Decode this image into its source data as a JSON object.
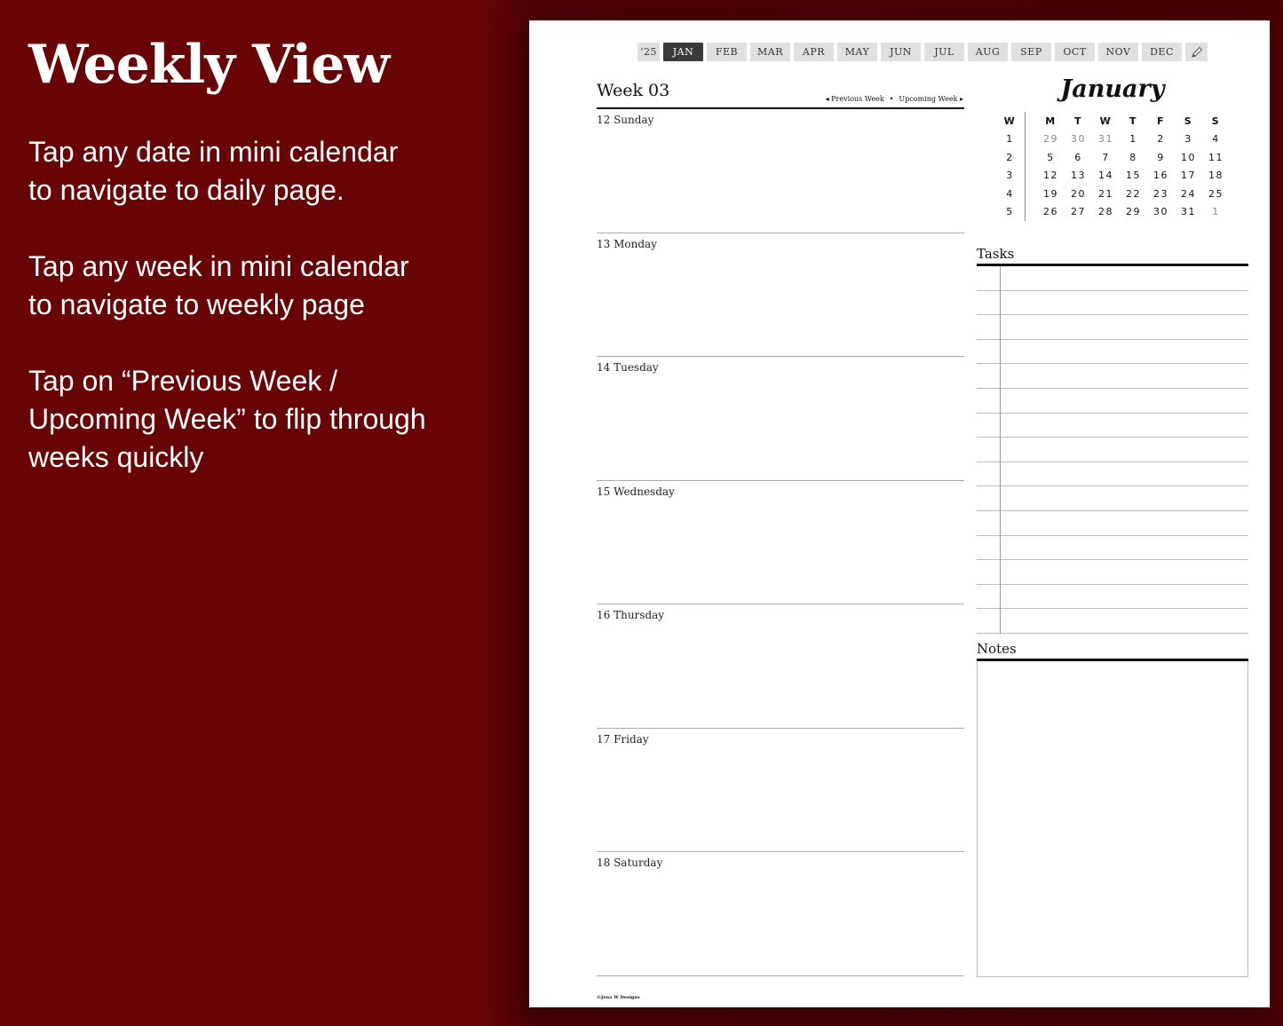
{
  "promo": {
    "title": "Weekly View",
    "tips": [
      "Tap any date in mini calendar\nto navigate to daily page.",
      "Tap any week in mini calendar\nto navigate to weekly page",
      "Tap on “Previous Week /\nUpcoming Week” to flip through\nweeks quickly"
    ]
  },
  "tabs": {
    "year": "‘25",
    "months": [
      "JAN",
      "FEB",
      "MAR",
      "APR",
      "MAY",
      "JUN",
      "JUL",
      "AUG",
      "SEP",
      "OCT",
      "NOV",
      "DEC"
    ],
    "active": "JAN",
    "edit_icon": "pencil-icon"
  },
  "week": {
    "title": "Week 03",
    "previous_label": "◂ Previous Week",
    "separator": "•",
    "upcoming_label": "Upcoming Week ▸",
    "days": [
      "12 Sunday",
      "13 Monday",
      "14 Tuesday",
      "15 Wednesday",
      "16 Thursday",
      "17 Friday",
      "18 Saturday"
    ]
  },
  "calendar": {
    "month": "January",
    "week_header": "W",
    "day_headers": [
      "M",
      "T",
      "W",
      "T",
      "F",
      "S",
      "S"
    ],
    "rows": [
      {
        "week": "1",
        "days": [
          {
            "d": "29",
            "dim": true
          },
          {
            "d": "30",
            "dim": true
          },
          {
            "d": "31",
            "dim": true
          },
          {
            "d": "1"
          },
          {
            "d": "2"
          },
          {
            "d": "3"
          },
          {
            "d": "4"
          }
        ]
      },
      {
        "week": "2",
        "days": [
          {
            "d": "5"
          },
          {
            "d": "6"
          },
          {
            "d": "7"
          },
          {
            "d": "8"
          },
          {
            "d": "9"
          },
          {
            "d": "10"
          },
          {
            "d": "11"
          }
        ]
      },
      {
        "week": "3",
        "days": [
          {
            "d": "12"
          },
          {
            "d": "13"
          },
          {
            "d": "14"
          },
          {
            "d": "15"
          },
          {
            "d": "16"
          },
          {
            "d": "17"
          },
          {
            "d": "18"
          }
        ]
      },
      {
        "week": "4",
        "days": [
          {
            "d": "19"
          },
          {
            "d": "20"
          },
          {
            "d": "21"
          },
          {
            "d": "22"
          },
          {
            "d": "23"
          },
          {
            "d": "24"
          },
          {
            "d": "25"
          }
        ]
      },
      {
        "week": "5",
        "days": [
          {
            "d": "26"
          },
          {
            "d": "27"
          },
          {
            "d": "28"
          },
          {
            "d": "29"
          },
          {
            "d": "30"
          },
          {
            "d": "31"
          },
          {
            "d": "1",
            "dim": true
          }
        ]
      }
    ]
  },
  "tasks": {
    "title": "Tasks",
    "row_count": 15
  },
  "notes": {
    "title": "Notes"
  },
  "footer": {
    "copyright": "©Jena W Designs"
  },
  "colors": {
    "background": "#680406",
    "active_tab": "#3a3a3a",
    "tab": "#e0e0e0"
  }
}
